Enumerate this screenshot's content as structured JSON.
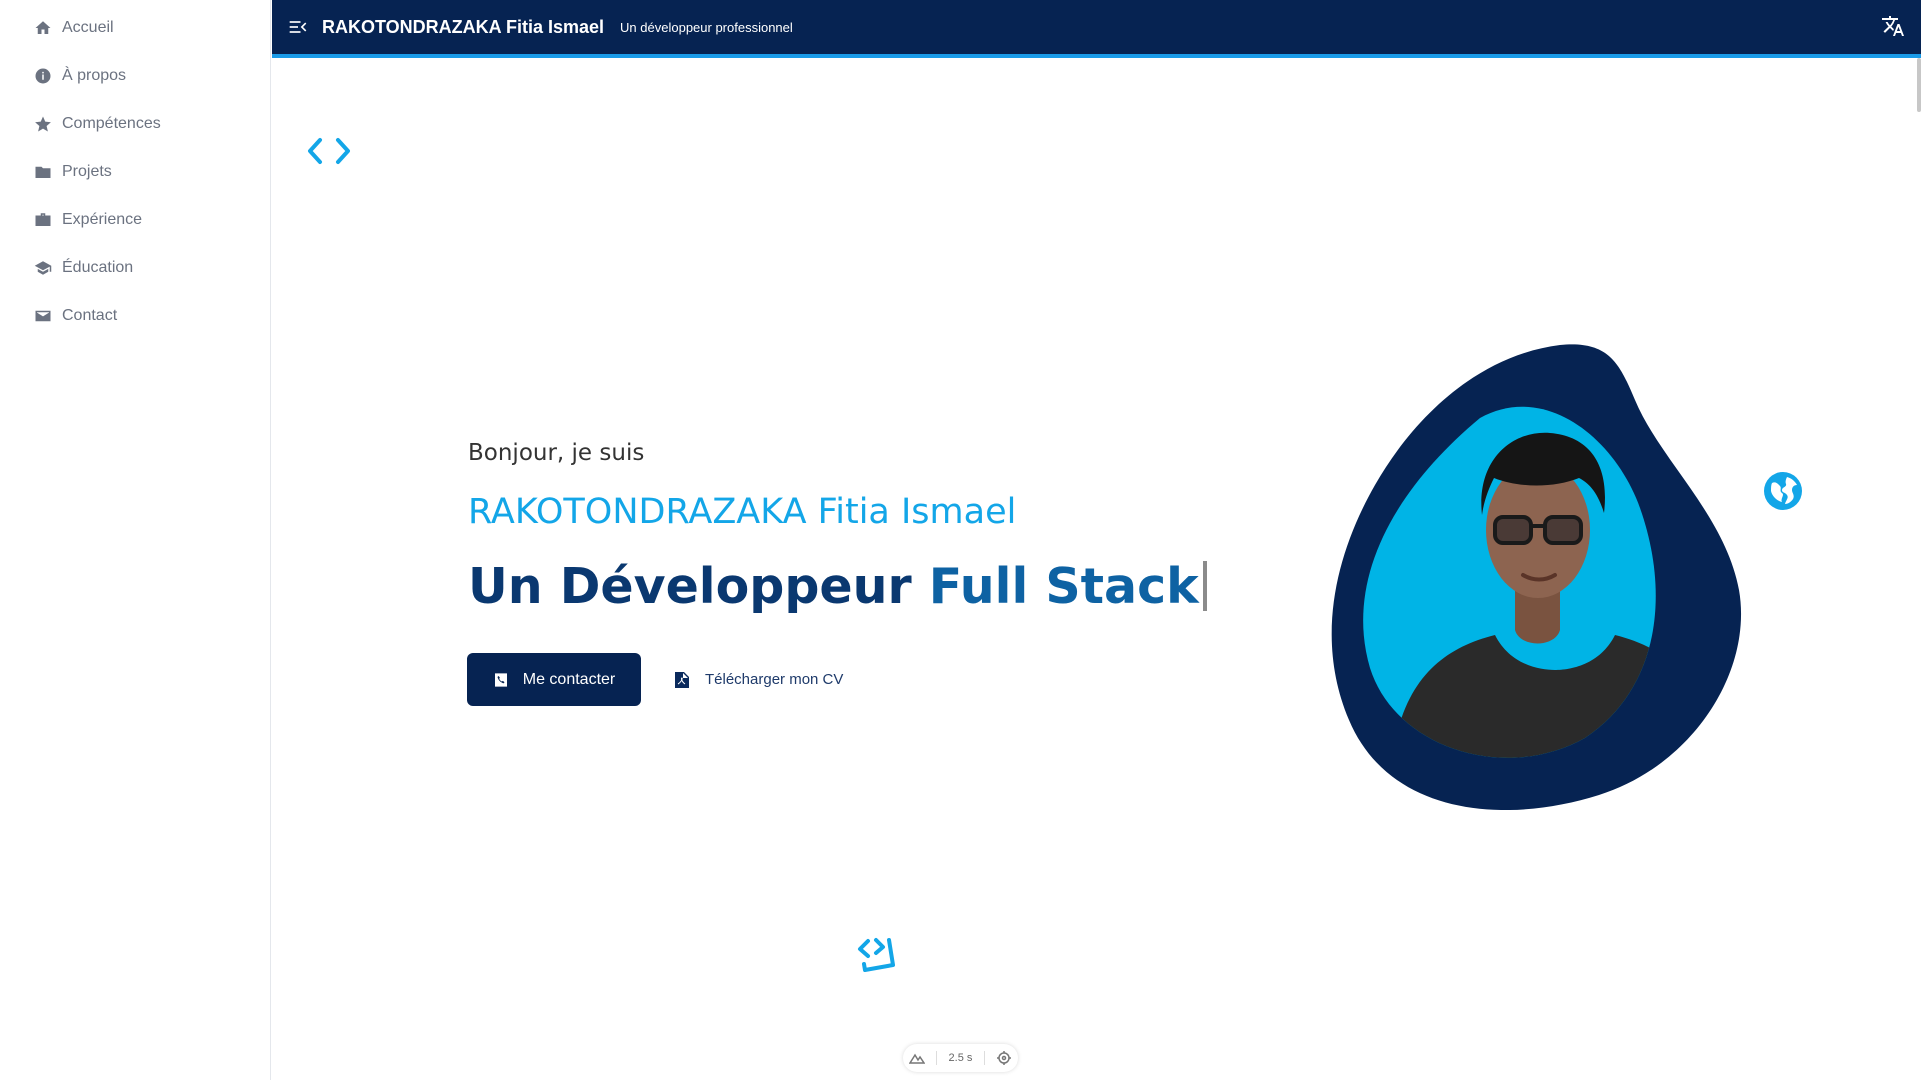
{
  "sidebar": {
    "items": [
      {
        "label": "Accueil",
        "icon": "home-icon"
      },
      {
        "label": "À propos",
        "icon": "info-icon"
      },
      {
        "label": "Compétences",
        "icon": "star-icon"
      },
      {
        "label": "Projets",
        "icon": "folder-icon"
      },
      {
        "label": "Expérience",
        "icon": "briefcase-icon"
      },
      {
        "label": "Éducation",
        "icon": "graduation-cap-icon"
      },
      {
        "label": "Contact",
        "icon": "envelope-icon"
      }
    ]
  },
  "topbar": {
    "title": "RAKOTONDRAZAKA Fitia Ismael",
    "tagline": "Un développeur professionnel",
    "menu_icon": "menu-collapse-icon",
    "translate_icon": "translate-icon"
  },
  "hero": {
    "greeting": "Bonjour, je suis",
    "name": "RAKOTONDRAZAKA Fitia Ismael",
    "headline_prefix": "Un Développeur ",
    "headline_highlight": "Full Stack",
    "contact_label": "Me contacter",
    "cv_label": "Télécharger mon CV"
  },
  "toolbar": {
    "timer": "2.5 s"
  },
  "colors": {
    "navy": "#062352",
    "accent": "#13a6e8",
    "blob_inner": "#00b4e6"
  }
}
